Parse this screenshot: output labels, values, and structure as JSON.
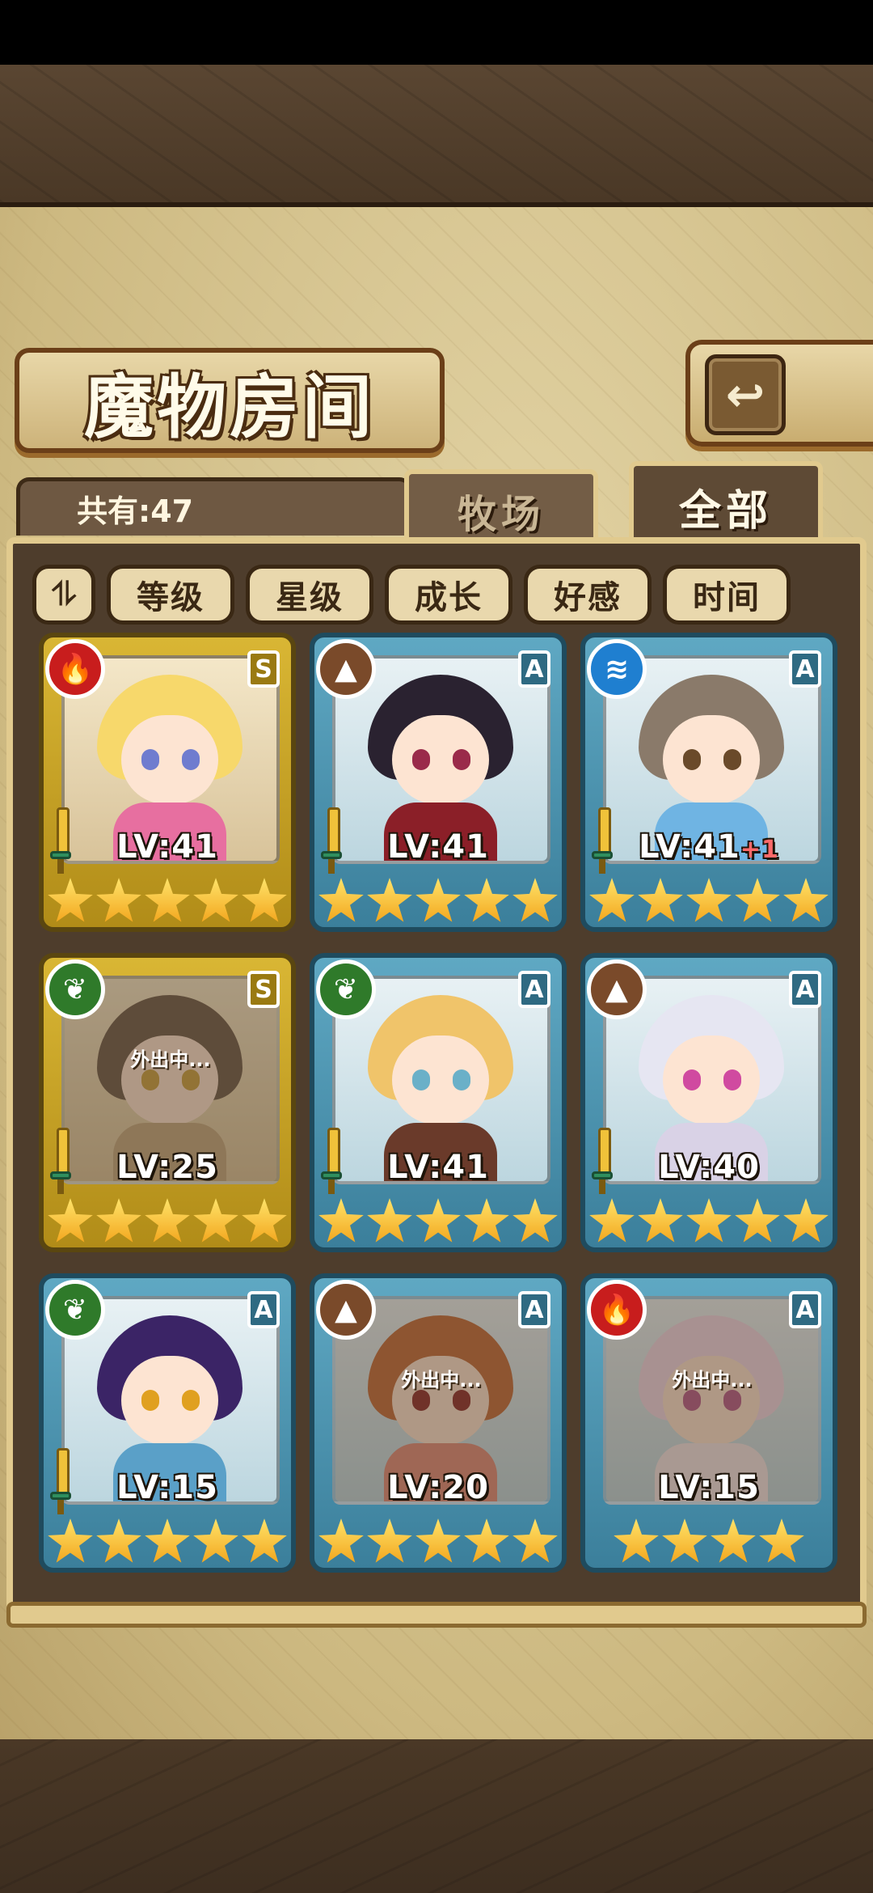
{
  "header": {
    "title": "魔物房间",
    "back_icon_glyph": "↩"
  },
  "count": {
    "label": "共有:47"
  },
  "tabs": [
    {
      "label": "牧场",
      "selected": false
    },
    {
      "label": "全部",
      "selected": true
    }
  ],
  "sort": {
    "toggle_glyph": "⥮",
    "buttons": [
      "等级",
      "星级",
      "成长",
      "好感",
      "时间"
    ]
  },
  "away_label": "外出中...",
  "elements": {
    "fire": {
      "icon": "fire-icon",
      "glyph": "🔥",
      "color": "#c81d1d"
    },
    "earth": {
      "icon": "mountain-icon",
      "glyph": "▲",
      "color": "#7a4a2a"
    },
    "water": {
      "icon": "wave-icon",
      "glyph": "≋",
      "color": "#1f7fd0"
    },
    "wood": {
      "icon": "leaf-icon",
      "glyph": "❦",
      "color": "#2f7a2a"
    }
  },
  "monsters": [
    {
      "element": "fire",
      "rank": "S",
      "level": "LV:41",
      "plus": "",
      "stars": 5,
      "away": false,
      "hair": "#f7d86b",
      "eye": "#6f7ccf",
      "body": "#e76fa0",
      "sword": true
    },
    {
      "element": "earth",
      "rank": "A",
      "level": "LV:41",
      "plus": "",
      "stars": 5,
      "away": false,
      "hair": "#2a2230",
      "eye": "#9a2a4a",
      "body": "#8b1f28",
      "sword": true
    },
    {
      "element": "water",
      "rank": "A",
      "level": "LV:41",
      "plus": "+1",
      "stars": 5,
      "away": false,
      "hair": "#8a7a6a",
      "eye": "#6a4a2a",
      "body": "#6fb4e3",
      "sword": true
    },
    {
      "element": "wood",
      "rank": "S",
      "level": "LV:25",
      "plus": "",
      "stars": 5,
      "away": true,
      "hair": "#6b5a4a",
      "eye": "#c9a040",
      "body": "#c2a880",
      "sword": true
    },
    {
      "element": "wood",
      "rank": "A",
      "level": "LV:41",
      "plus": "",
      "stars": 5,
      "away": false,
      "hair": "#f0c46a",
      "eye": "#6ab0c8",
      "body": "#6a3a2a",
      "sword": true
    },
    {
      "element": "earth",
      "rank": "A",
      "level": "LV:40",
      "plus": "",
      "stars": 5,
      "away": false,
      "hair": "#e6e6f2",
      "eye": "#d04aa0",
      "body": "#d9d2e6",
      "sword": true
    },
    {
      "element": "wood",
      "rank": "A",
      "level": "LV:15",
      "plus": "",
      "stars": 5,
      "away": false,
      "hair": "#3b2466",
      "eye": "#e0a020",
      "body": "#5aa0c8",
      "sword": true
    },
    {
      "element": "earth",
      "rank": "A",
      "level": "LV:20",
      "plus": "",
      "stars": 5,
      "away": true,
      "hair": "#c26a3a",
      "eye": "#8a2a2a",
      "body": "#e08a7a",
      "sword": false
    },
    {
      "element": "fire",
      "rank": "A",
      "level": "LV:15",
      "plus": "",
      "stars": 4,
      "away": true,
      "hair": "#f0d8e8",
      "eye": "#b45a8a",
      "body": "#f3e6ea",
      "sword": false
    }
  ]
}
